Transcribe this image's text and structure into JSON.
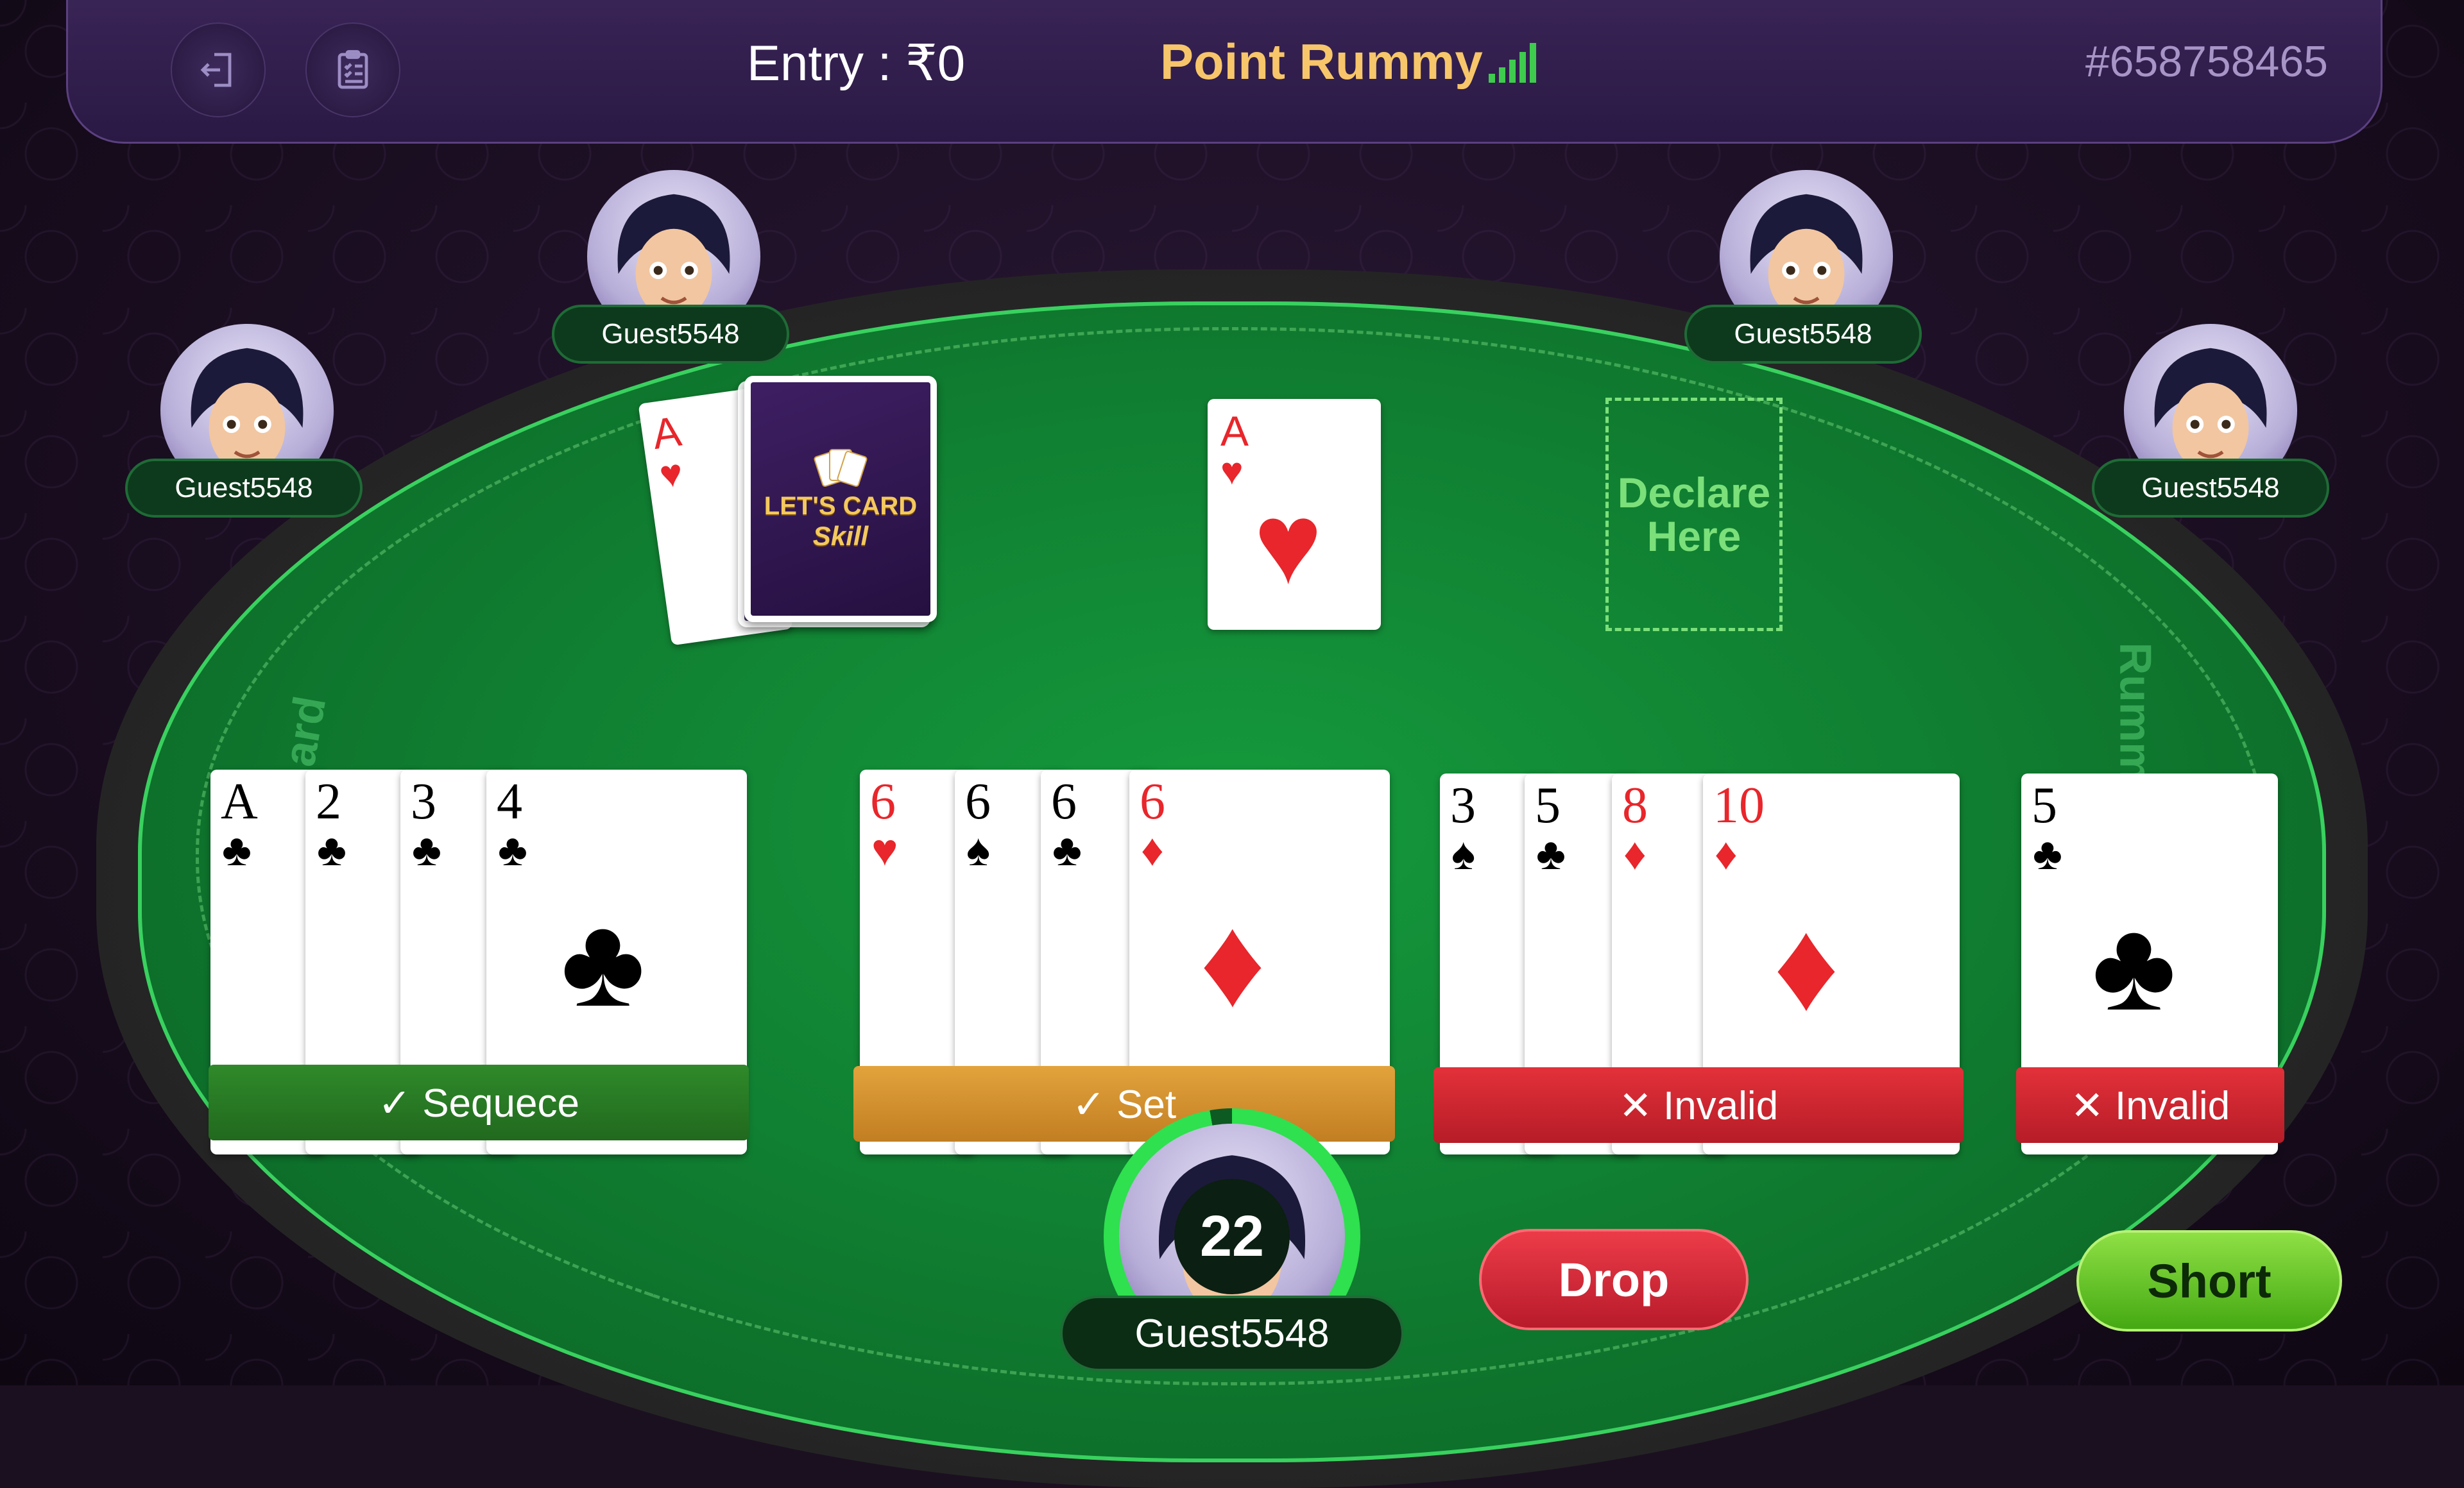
{
  "header": {
    "entry_label": "Entry : ₹0",
    "game_title": "Point Rummy",
    "table_id": "#658758465",
    "exit_icon": "exit-icon",
    "scorecard_icon": "clipboard-icon",
    "signal_icon": "signal-icon"
  },
  "felt": {
    "left_text": "ard",
    "right_text": "Rummy"
  },
  "players": [
    {
      "name": "Guest5548"
    },
    {
      "name": "Guest5548"
    },
    {
      "name": "Guest5548"
    },
    {
      "name": "Guest5548"
    }
  ],
  "deck": {
    "joker_rank": "A",
    "joker_suit": "♥",
    "brand_line1": "LET'S CARD",
    "brand_line2": "Skill"
  },
  "discard": {
    "rank": "A",
    "suit": "♥"
  },
  "declare_zone": {
    "label": "Declare Here"
  },
  "groups": [
    {
      "label": "✓ Sequece",
      "status": "valid"
    },
    {
      "label": "✓ Set",
      "status": "valid"
    },
    {
      "label": "✕ Invalid",
      "status": "invalid"
    },
    {
      "label": "✕ Invalid",
      "status": "invalid"
    }
  ],
  "hand": [
    [
      {
        "rank": "A",
        "suit": "♣"
      },
      {
        "rank": "2",
        "suit": "♣"
      },
      {
        "rank": "3",
        "suit": "♣"
      },
      {
        "rank": "4",
        "suit": "♣"
      }
    ],
    [
      {
        "rank": "6",
        "suit": "♥"
      },
      {
        "rank": "6",
        "suit": "♠"
      },
      {
        "rank": "6",
        "suit": "♣"
      },
      {
        "rank": "6",
        "suit": "♦"
      }
    ],
    [
      {
        "rank": "3",
        "suit": "♠"
      },
      {
        "rank": "5",
        "suit": "♣"
      },
      {
        "rank": "8",
        "suit": "♦"
      },
      {
        "rank": "10",
        "suit": "♦"
      }
    ],
    [
      {
        "rank": "5",
        "suit": "♣"
      }
    ]
  ],
  "self": {
    "name": "Guest5548",
    "timer": "22"
  },
  "actions": {
    "drop_label": "Drop",
    "short_label": "Short"
  },
  "colors": {
    "accent_gold": "#f7c66a",
    "felt_green": "#0f7a2f",
    "drop_red": "#e3313a",
    "short_green": "#8ee044"
  }
}
